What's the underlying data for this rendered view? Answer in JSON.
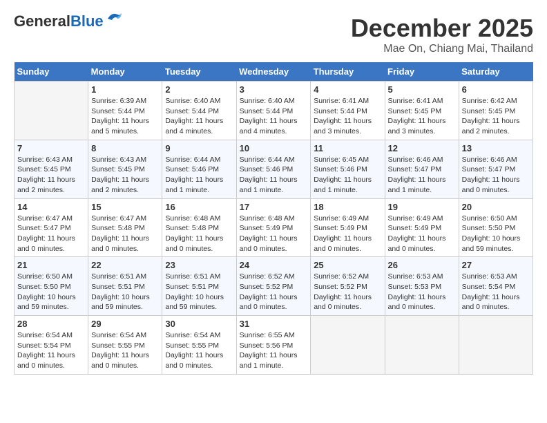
{
  "header": {
    "logo_general": "General",
    "logo_blue": "Blue",
    "month": "December 2025",
    "location": "Mae On, Chiang Mai, Thailand"
  },
  "weekdays": [
    "Sunday",
    "Monday",
    "Tuesday",
    "Wednesday",
    "Thursday",
    "Friday",
    "Saturday"
  ],
  "weeks": [
    [
      {
        "day": "",
        "info": ""
      },
      {
        "day": "1",
        "info": "Sunrise: 6:39 AM\nSunset: 5:44 PM\nDaylight: 11 hours\nand 5 minutes."
      },
      {
        "day": "2",
        "info": "Sunrise: 6:40 AM\nSunset: 5:44 PM\nDaylight: 11 hours\nand 4 minutes."
      },
      {
        "day": "3",
        "info": "Sunrise: 6:40 AM\nSunset: 5:44 PM\nDaylight: 11 hours\nand 4 minutes."
      },
      {
        "day": "4",
        "info": "Sunrise: 6:41 AM\nSunset: 5:44 PM\nDaylight: 11 hours\nand 3 minutes."
      },
      {
        "day": "5",
        "info": "Sunrise: 6:41 AM\nSunset: 5:45 PM\nDaylight: 11 hours\nand 3 minutes."
      },
      {
        "day": "6",
        "info": "Sunrise: 6:42 AM\nSunset: 5:45 PM\nDaylight: 11 hours\nand 2 minutes."
      }
    ],
    [
      {
        "day": "7",
        "info": "Sunrise: 6:43 AM\nSunset: 5:45 PM\nDaylight: 11 hours\nand 2 minutes."
      },
      {
        "day": "8",
        "info": "Sunrise: 6:43 AM\nSunset: 5:45 PM\nDaylight: 11 hours\nand 2 minutes."
      },
      {
        "day": "9",
        "info": "Sunrise: 6:44 AM\nSunset: 5:46 PM\nDaylight: 11 hours\nand 1 minute."
      },
      {
        "day": "10",
        "info": "Sunrise: 6:44 AM\nSunset: 5:46 PM\nDaylight: 11 hours\nand 1 minute."
      },
      {
        "day": "11",
        "info": "Sunrise: 6:45 AM\nSunset: 5:46 PM\nDaylight: 11 hours\nand 1 minute."
      },
      {
        "day": "12",
        "info": "Sunrise: 6:46 AM\nSunset: 5:47 PM\nDaylight: 11 hours\nand 1 minute."
      },
      {
        "day": "13",
        "info": "Sunrise: 6:46 AM\nSunset: 5:47 PM\nDaylight: 11 hours\nand 0 minutes."
      }
    ],
    [
      {
        "day": "14",
        "info": "Sunrise: 6:47 AM\nSunset: 5:47 PM\nDaylight: 11 hours\nand 0 minutes."
      },
      {
        "day": "15",
        "info": "Sunrise: 6:47 AM\nSunset: 5:48 PM\nDaylight: 11 hours\nand 0 minutes."
      },
      {
        "day": "16",
        "info": "Sunrise: 6:48 AM\nSunset: 5:48 PM\nDaylight: 11 hours\nand 0 minutes."
      },
      {
        "day": "17",
        "info": "Sunrise: 6:48 AM\nSunset: 5:49 PM\nDaylight: 11 hours\nand 0 minutes."
      },
      {
        "day": "18",
        "info": "Sunrise: 6:49 AM\nSunset: 5:49 PM\nDaylight: 11 hours\nand 0 minutes."
      },
      {
        "day": "19",
        "info": "Sunrise: 6:49 AM\nSunset: 5:49 PM\nDaylight: 11 hours\nand 0 minutes."
      },
      {
        "day": "20",
        "info": "Sunrise: 6:50 AM\nSunset: 5:50 PM\nDaylight: 10 hours\nand 59 minutes."
      }
    ],
    [
      {
        "day": "21",
        "info": "Sunrise: 6:50 AM\nSunset: 5:50 PM\nDaylight: 10 hours\nand 59 minutes."
      },
      {
        "day": "22",
        "info": "Sunrise: 6:51 AM\nSunset: 5:51 PM\nDaylight: 10 hours\nand 59 minutes."
      },
      {
        "day": "23",
        "info": "Sunrise: 6:51 AM\nSunset: 5:51 PM\nDaylight: 10 hours\nand 59 minutes."
      },
      {
        "day": "24",
        "info": "Sunrise: 6:52 AM\nSunset: 5:52 PM\nDaylight: 11 hours\nand 0 minutes."
      },
      {
        "day": "25",
        "info": "Sunrise: 6:52 AM\nSunset: 5:52 PM\nDaylight: 11 hours\nand 0 minutes."
      },
      {
        "day": "26",
        "info": "Sunrise: 6:53 AM\nSunset: 5:53 PM\nDaylight: 11 hours\nand 0 minutes."
      },
      {
        "day": "27",
        "info": "Sunrise: 6:53 AM\nSunset: 5:54 PM\nDaylight: 11 hours\nand 0 minutes."
      }
    ],
    [
      {
        "day": "28",
        "info": "Sunrise: 6:54 AM\nSunset: 5:54 PM\nDaylight: 11 hours\nand 0 minutes."
      },
      {
        "day": "29",
        "info": "Sunrise: 6:54 AM\nSunset: 5:55 PM\nDaylight: 11 hours\nand 0 minutes."
      },
      {
        "day": "30",
        "info": "Sunrise: 6:54 AM\nSunset: 5:55 PM\nDaylight: 11 hours\nand 0 minutes."
      },
      {
        "day": "31",
        "info": "Sunrise: 6:55 AM\nSunset: 5:56 PM\nDaylight: 11 hours\nand 1 minute."
      },
      {
        "day": "",
        "info": ""
      },
      {
        "day": "",
        "info": ""
      },
      {
        "day": "",
        "info": ""
      }
    ]
  ]
}
